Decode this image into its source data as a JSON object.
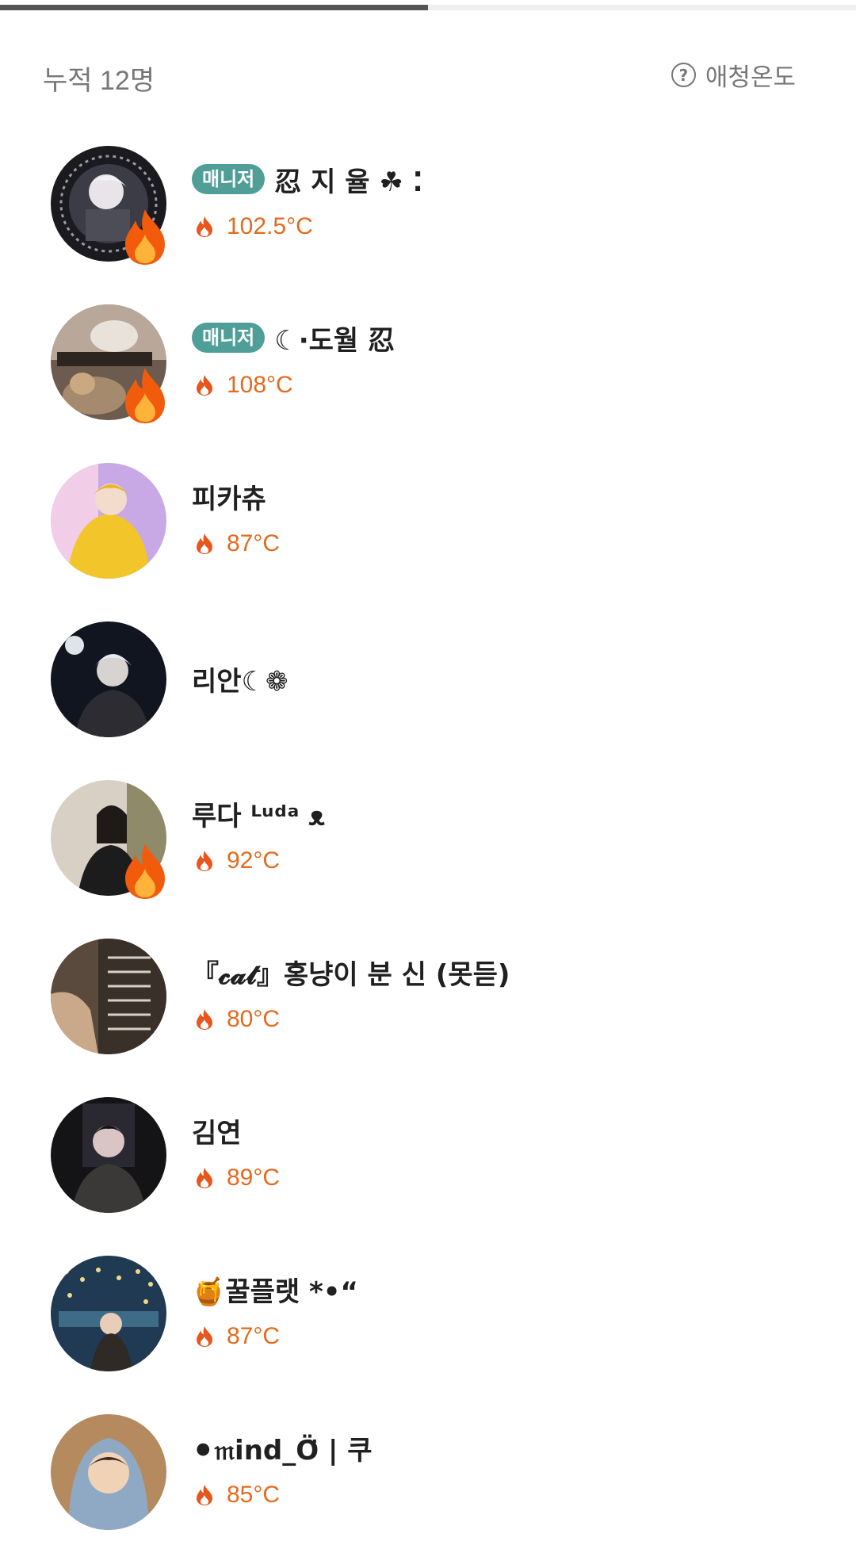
{
  "progress": {
    "fraction": 0.5
  },
  "header": {
    "count_label": "누적 12명",
    "help_icon": "help-circle-icon",
    "info_label": "애청온도"
  },
  "colors": {
    "manager_badge": "#4f9e97",
    "temperature": "#e46a1e",
    "muted_text": "#777777",
    "progress_fill": "#555555"
  },
  "badge_label": "매니저",
  "members": [
    {
      "name": "忍 지 율 ☘︎ ⁚",
      "manager": true,
      "temperature": "102.5°C",
      "hot_badge": true
    },
    {
      "name": "☾·도월  忍",
      "manager": true,
      "temperature": "108°C",
      "hot_badge": true
    },
    {
      "name": "피카츄",
      "manager": false,
      "temperature": "87°C",
      "hot_badge": false
    },
    {
      "name": "리안☾❁",
      "manager": false,
      "temperature": "",
      "hot_badge": false
    },
    {
      "name": "루다 ᴸᵘᵈᵃ    ᴥ",
      "manager": false,
      "temperature": "92°C",
      "hot_badge": true
    },
    {
      "name": "『𝓬𝓪𝓽』홍냥이 분 신 (못듣)",
      "manager": false,
      "temperature": "80°C",
      "hot_badge": false
    },
    {
      "name": "김연",
      "manager": false,
      "temperature": "89°C",
      "hot_badge": false
    },
    {
      "name": "🍯꿀플랫      *•“",
      "manager": false,
      "temperature": "87°C",
      "hot_badge": false
    },
    {
      "name": "⚫𝔪ind_Ö̈ | 쿠",
      "manager": false,
      "temperature": "85°C",
      "hot_badge": false
    }
  ]
}
